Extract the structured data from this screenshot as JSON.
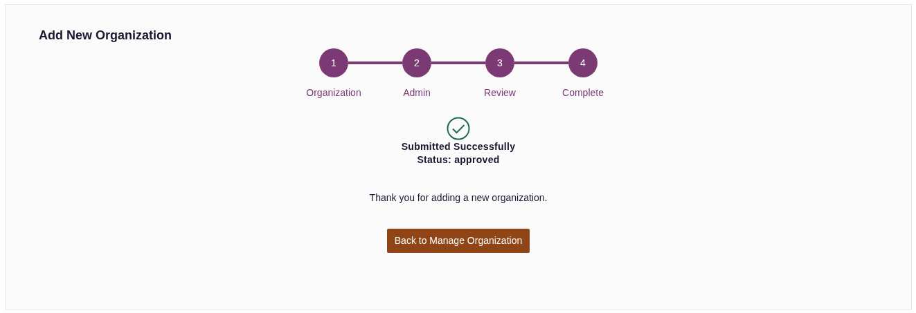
{
  "page": {
    "title": "Add New Organization"
  },
  "steps": [
    {
      "number": "1",
      "label": "Organization"
    },
    {
      "number": "2",
      "label": "Admin"
    },
    {
      "number": "3",
      "label": "Review"
    },
    {
      "number": "4",
      "label": "Complete"
    }
  ],
  "result": {
    "heading": "Submitted Successfully",
    "status": "Status: approved",
    "message": "Thank you for adding a new organization."
  },
  "button": {
    "label": "Back to Manage Organization"
  }
}
